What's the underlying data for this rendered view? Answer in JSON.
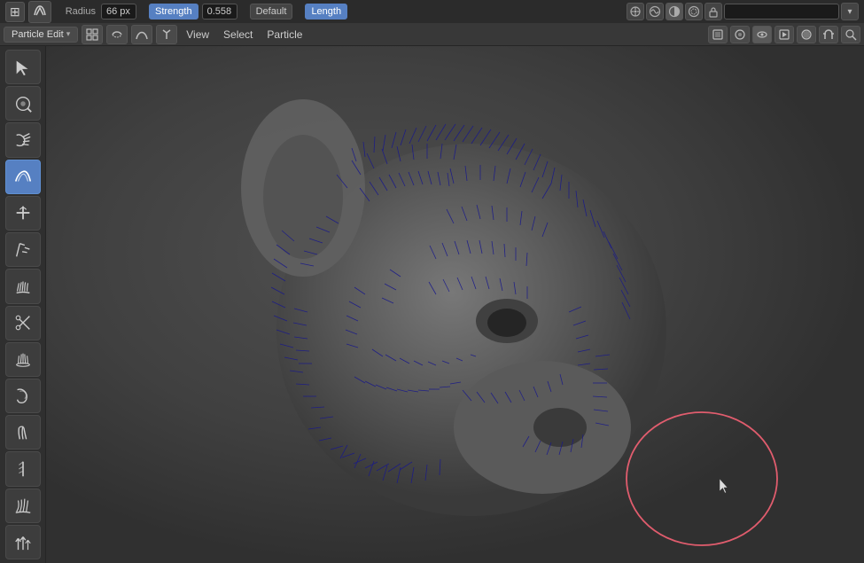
{
  "topbar": {
    "workspace_icon": "⊞",
    "mode_icon": "~",
    "radius_label": "Radius",
    "radius_value": "66 px",
    "strength_label": "Strength",
    "strength_value": "0.558",
    "falloff_label": "Default",
    "length_label": "Length",
    "icons_right": [
      "⊙",
      "≡",
      "○",
      "∧"
    ],
    "search_placeholder": ""
  },
  "secondbar": {
    "mode_label": "Particle Edit",
    "mode_icons": [
      "grid",
      "curve",
      "bezier",
      "branch"
    ],
    "view_label": "View",
    "select_label": "Select",
    "particle_label": "Particle",
    "right_icons": [
      "□",
      "circle",
      "eye",
      "lock",
      "magnet",
      "⌕"
    ]
  },
  "toolbar": {
    "tools": [
      {
        "name": "select",
        "icon": "⊹",
        "active": false
      },
      {
        "name": "select-circle",
        "icon": "◎",
        "active": false
      },
      {
        "name": "comb",
        "icon": "comb",
        "active": false
      },
      {
        "name": "smooth",
        "icon": "smooth",
        "active": true
      },
      {
        "name": "add",
        "icon": "add",
        "active": false
      },
      {
        "name": "length",
        "icon": "length",
        "active": false
      },
      {
        "name": "puff",
        "icon": "puff",
        "active": false
      },
      {
        "name": "cut",
        "icon": "cut",
        "active": false
      },
      {
        "name": "weight",
        "icon": "weight",
        "active": false
      },
      {
        "name": "curl",
        "icon": "curl",
        "active": false
      },
      {
        "name": "clump",
        "icon": "clump",
        "active": false
      },
      {
        "name": "straighten",
        "icon": "straighten",
        "active": false
      },
      {
        "name": "comb2",
        "icon": "comb2",
        "active": false
      },
      {
        "name": "grow",
        "icon": "grow",
        "active": false
      }
    ]
  },
  "viewport": {
    "bg_color": "#3d3d3d",
    "brush_circle_color": "rgba(255,100,120,0.85)"
  }
}
